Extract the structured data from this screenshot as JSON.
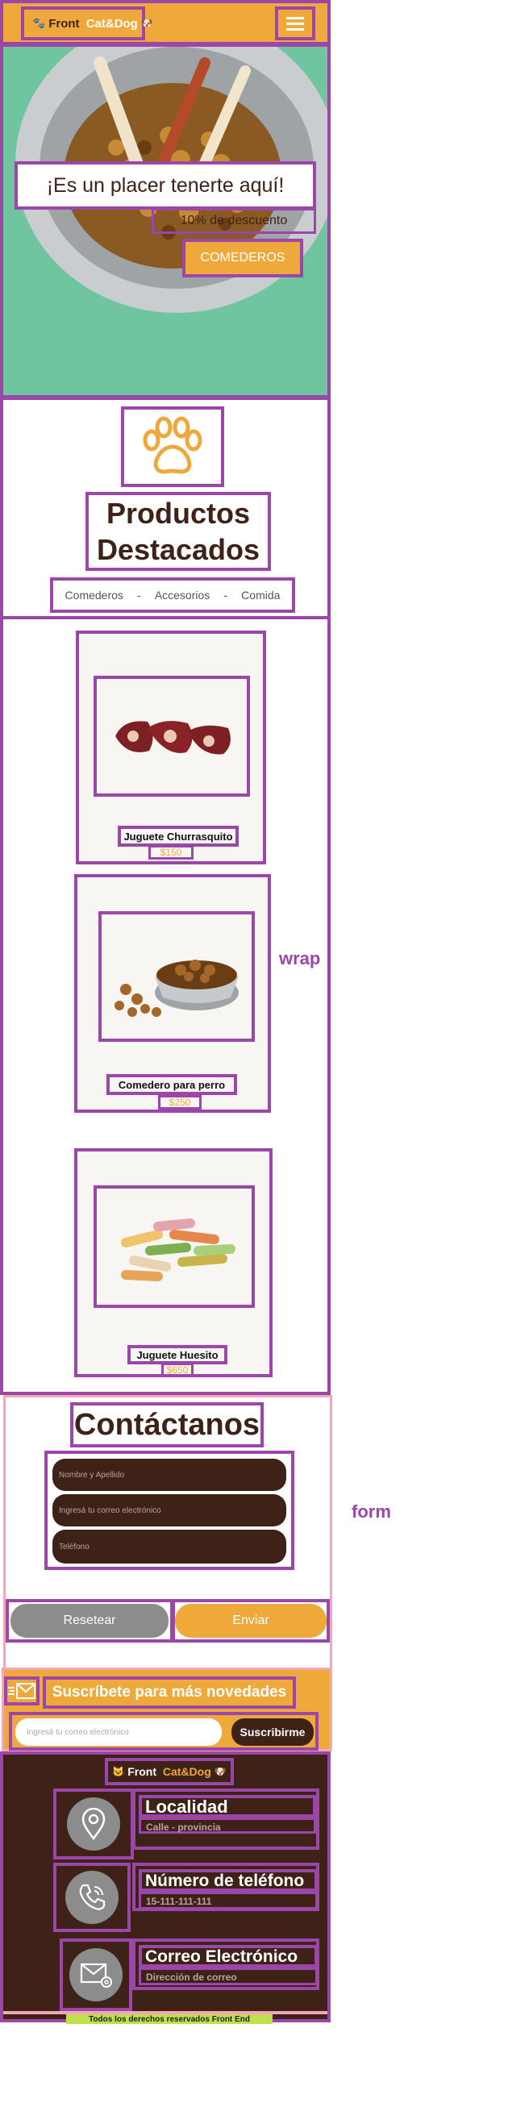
{
  "colors": {
    "accent": "#efa93a",
    "dark_brown": "#3f2217",
    "outline_purple": "#9c46aa",
    "pink": "#f2a7b8",
    "lime": "#bfe04d",
    "grey_button": "#8c8c8c"
  },
  "header": {
    "brand_prefix": "Front ",
    "brand_name": "Cat&Dog"
  },
  "hero": {
    "title": "¡Es un placer tenerte aquí!",
    "subtitle": "10% de descuento",
    "button": "COMEDEROS"
  },
  "featured": {
    "title_line1": "Productos",
    "title_line2": "Destacados",
    "filters": [
      "Comederos",
      "-",
      "Accesorios",
      "-",
      "Comida"
    ]
  },
  "products": [
    {
      "name": "Juguete Churrasquito",
      "price": "$150",
      "image": "meat-toy-image"
    },
    {
      "name": "Comedero para perro",
      "price": "$250",
      "image": "dog-bowl-image"
    },
    {
      "name": "Juguete Huesito",
      "price": "$650",
      "image": "bone-toy-image"
    }
  ],
  "wrap_label": "wrap",
  "form_label": "form",
  "contact": {
    "title": "Contáctanos",
    "fields": {
      "name": "Nombre y Apellido",
      "email": "Ingresá tu correo electrónico",
      "phone": "Teléfono"
    },
    "reset": "Resetear",
    "submit": "Enviar"
  },
  "newsletter": {
    "title": "Suscríbete para más novedades",
    "placeholder": "Ingresá tu correo electrónico",
    "button": "Suscribirme"
  },
  "footer": {
    "brand_prefix": "Front ",
    "brand_name": "Cat&Dog",
    "location_title": "Localidad",
    "location_value": "Calle - provincia",
    "phone_title": "Número de teléfono",
    "phone_value": "15-111-111-111",
    "email_title": "Correo Electrónico",
    "email_value": "Dirección de correo",
    "copyright": "Todos los derechos reservados Front End"
  }
}
